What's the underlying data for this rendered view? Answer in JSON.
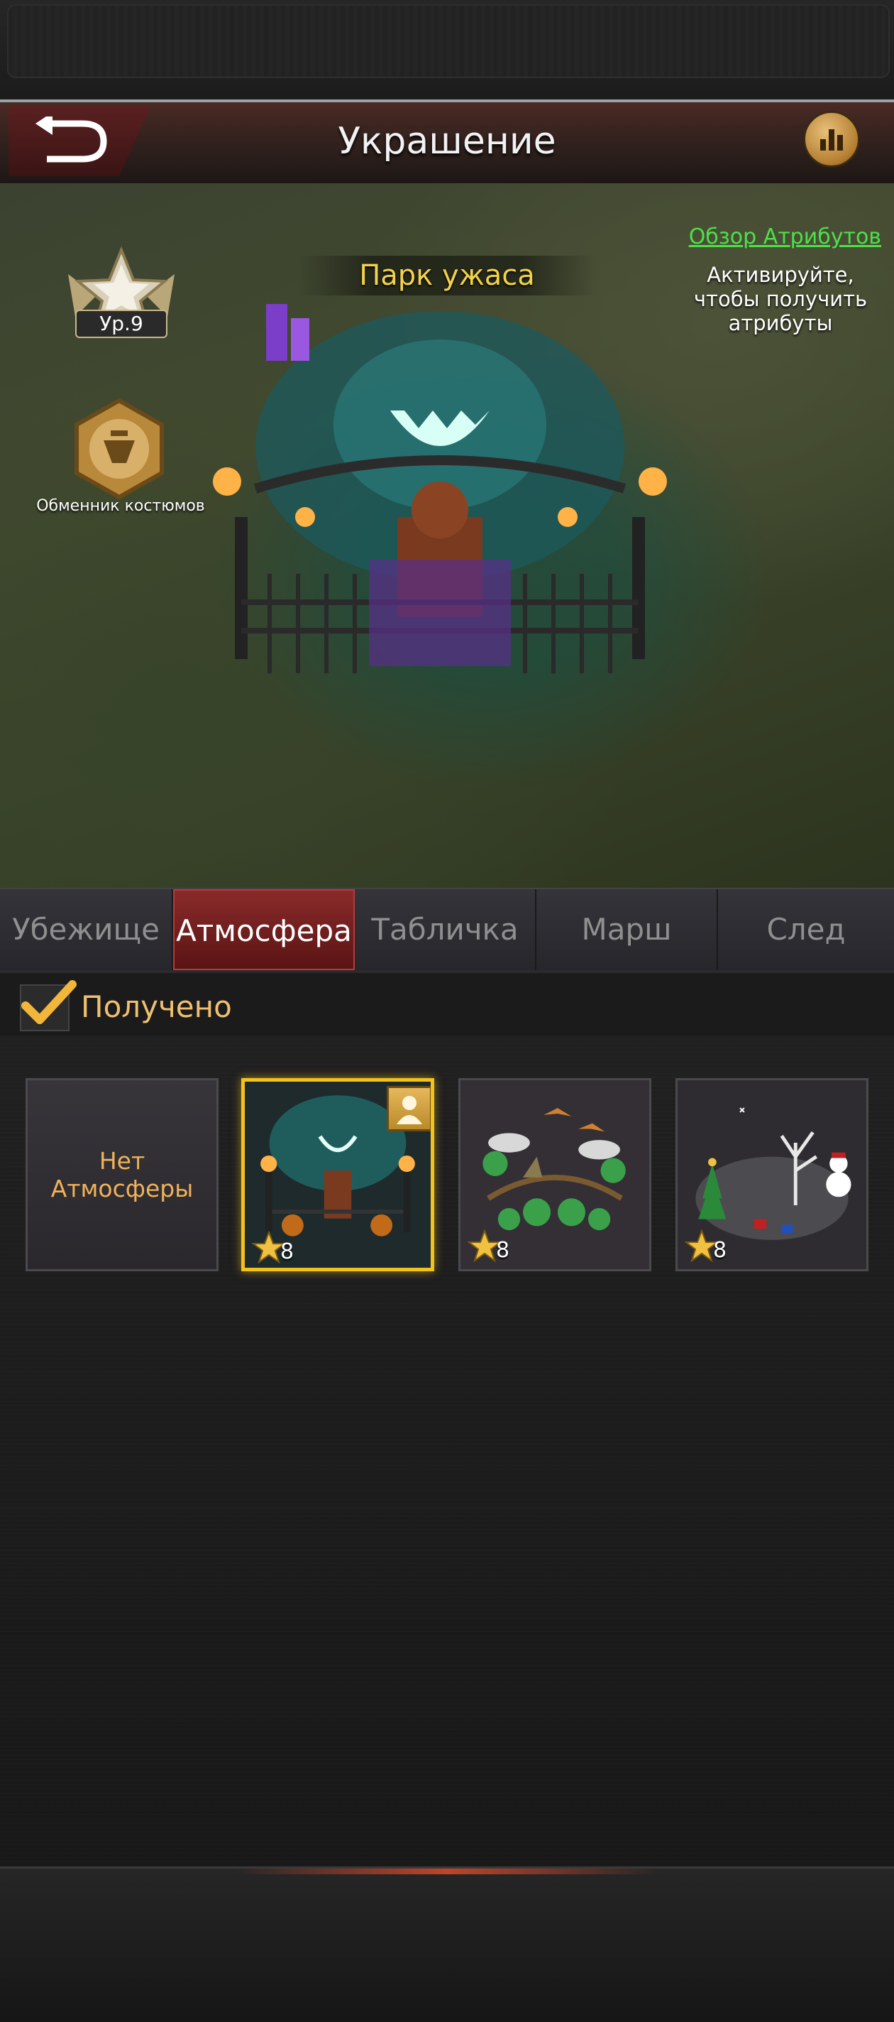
{
  "header": {
    "title": "Украшение"
  },
  "scene": {
    "place_name": "Парк ужаса",
    "attributes_link": "Обзор Атрибутов",
    "attributes_note": "Активируйте, чтобы получить атрибуты",
    "level": "Ур.9",
    "costume_exchanger": "Обменник костюмов"
  },
  "tabs": [
    {
      "label": "Убежище",
      "active": false
    },
    {
      "label": "Атмосфера",
      "active": true
    },
    {
      "label": "Табличка",
      "active": false
    },
    {
      "label": "Марш",
      "active": false
    },
    {
      "label": "След",
      "active": false
    }
  ],
  "filter": {
    "label": "Получено",
    "checked": true
  },
  "items": [
    {
      "label": "Нет Атмосферы"
    },
    {
      "stars": "8",
      "selected": true
    },
    {
      "stars": "8",
      "selected": false
    },
    {
      "stars": "8",
      "selected": false
    }
  ],
  "colors": {
    "accent_gold": "#f2c21d",
    "link_green": "#4ee04a",
    "tab_active": "#8a2a2a"
  }
}
